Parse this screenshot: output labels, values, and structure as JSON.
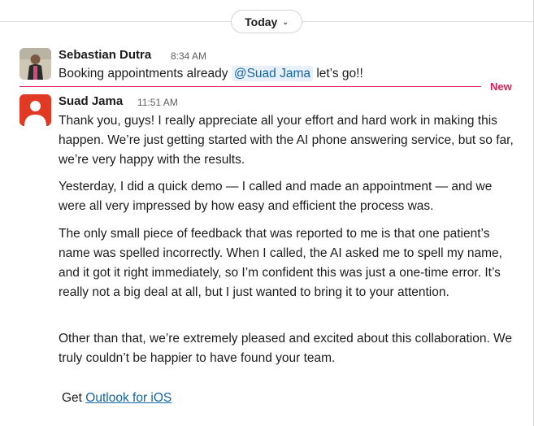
{
  "date_divider": {
    "label": "Today"
  },
  "messages": [
    {
      "author": "Sebastian Dutra",
      "time": "8:34 AM",
      "text_before": "Booking appointments already",
      "mention": "@Suad Jama",
      "text_after": "let’s go!!"
    },
    {
      "author": "Suad Jama",
      "time": "11:51 AM",
      "paragraphs": [
        "Thank you, guys! I really appreciate all your effort and hard work in making this happen. We’re just getting started with the AI phone answering service, but so far, we’re very happy with the results.",
        "Yesterday, I did a quick demo — I called and made an appointment — and we were all very impressed by how easy and efficient the process was.",
        "The only small piece of feedback that was reported to me is that one patient’s name was spelled incorrectly. When I called, the AI asked me to spell my name, and it got it right immediately, so I’m confident this was just a one-time error. It’s really not a big deal at all, but I just wanted to bring it to your attention.",
        "Other than that, we’re extremely pleased and excited about this collaboration. We truly couldn’t be happier to have found your team."
      ],
      "signature_prefix": "Get",
      "signature_link": "Outlook for iOS"
    }
  ],
  "new_divider": {
    "label": "New",
    "color": "#e01e5a"
  },
  "colors": {
    "mention_bg": "#e8f1fb",
    "link": "#1264a3",
    "avatar_suad": "#e03a25"
  }
}
